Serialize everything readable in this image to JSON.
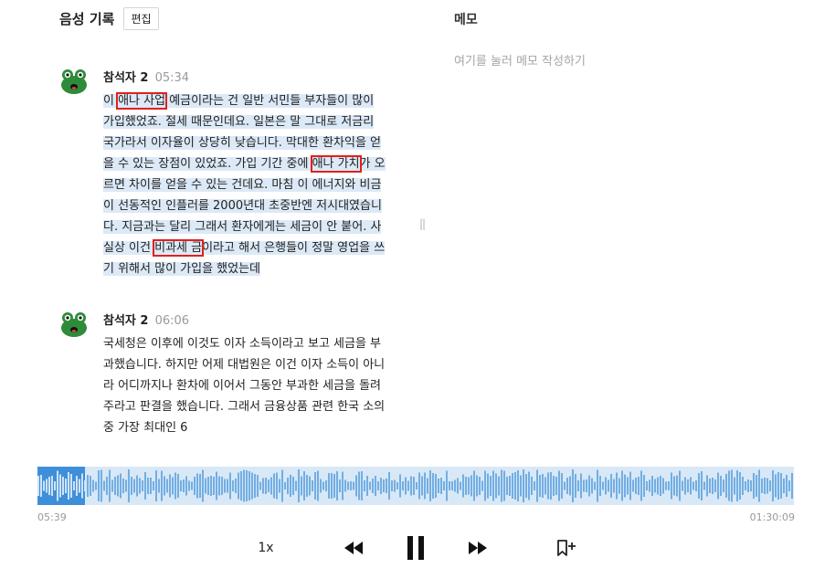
{
  "header": {
    "title": "음성 기록",
    "edit_label": "편집"
  },
  "memo": {
    "title": "메모",
    "placeholder": "여기를 눌러 메모 작성하기"
  },
  "segments": [
    {
      "speaker": "참석자 2",
      "time": "05:34",
      "parts": [
        "이 ",
        "애나 사업",
        " 예금이라는 건 일반 서민들 부자들이 많이 가입했었죠. 절세 때문인데요. 일본은 말 그대로 저금리 국가라서 이자율이 상당히 낮습니다. 막대한 환차익을 얻을 수 있는 장점이 있었죠. 가입 기간 중에 ",
        "애나 가치",
        "가 오르면 차이를 얻을 수 있는 건데요. 마침 이 에너지와 비금이 선동적인 인플러를 2000년대 초중반엔 저시대였습니다. 지금과는 달리 그래서 환자에게는 세금이 안 붙어. 사실상 이건 ",
        "비과세 금",
        "이라고 해서 은행들이 정말 영업을 쓰기 위해서 많이 가입을 했었는데"
      ]
    },
    {
      "speaker": "참석자 2",
      "time": "06:06",
      "text": "국세청은 이후에 이것도 이자 소득이라고 보고 세금을 부과했습니다. 하지만 어제 대법원은 이건 이자 소득이 아니라 어디까지나 환차에 이어서 그동안 부과한 세금을 돌려주라고 판결을 했습니다. 그래서 금융상품 관련 한국 소의 중 가장 최대인 6"
    }
  ],
  "player": {
    "current_time": "05:39",
    "total_time": "01:30:09",
    "progress_fraction": 0.063,
    "speed": "1x"
  },
  "colors": {
    "highlight": "#dce9f7",
    "box": "#e0201d",
    "wave_played": "#3e8fd9",
    "wave_bar": "#72aee3",
    "wave_bg": "#d8e8f6",
    "avatar": "#2e8b3a"
  },
  "icons": {
    "avatar": "frog-avatar-icon",
    "rewind": "rewind-icon",
    "pause": "pause-icon",
    "forward": "fast-forward-icon",
    "bookmark": "bookmark-add-icon"
  }
}
